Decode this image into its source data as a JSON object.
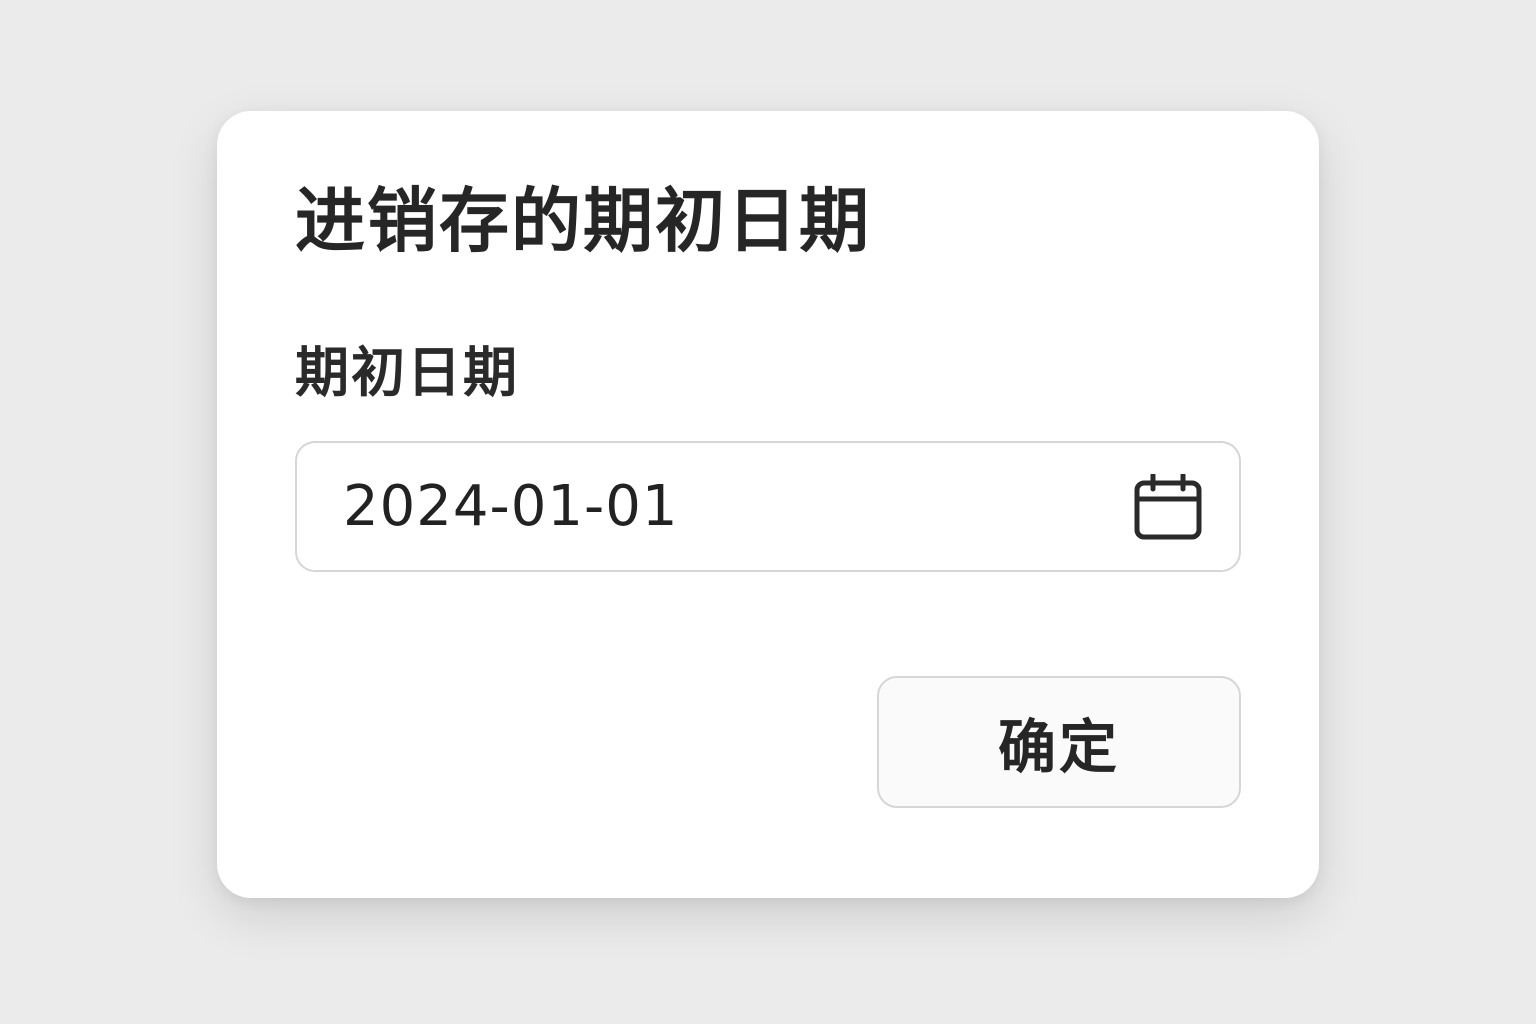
{
  "dialog": {
    "title": "进销存的期初日期",
    "field": {
      "label": "期初日期",
      "value": "2024-01-01",
      "icon": "calendar-icon"
    },
    "confirm_label": "确定"
  },
  "colors": {
    "background": "#ebebeb",
    "card": "#ffffff",
    "text": "#262626",
    "border": "#d6d6d6",
    "button_bg": "#fafafa"
  }
}
